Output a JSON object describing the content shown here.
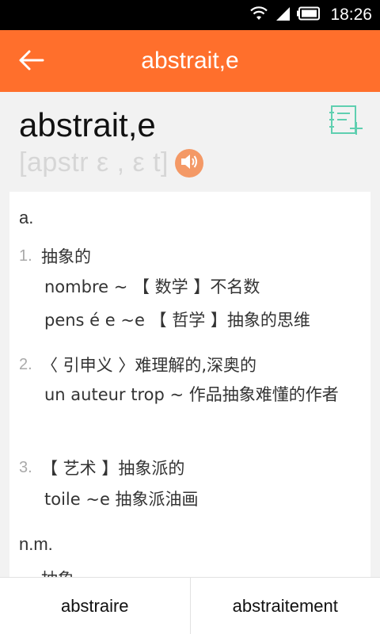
{
  "status_bar": {
    "time": "18:26",
    "icons": [
      "wifi-icon",
      "signal-icon",
      "battery-icon"
    ]
  },
  "app_bar": {
    "title": "abstrait,e",
    "back_icon": "arrow-left-icon"
  },
  "entry": {
    "word": "abstrait,e",
    "phonetic": "[apstr ε , ε t]",
    "speaker_icon": "speaker-icon",
    "add_icon": "add-to-notebook-icon"
  },
  "definitions": [
    {
      "pos": "a.",
      "senses": [
        {
          "num": "1.",
          "text": "抽象的",
          "examples": [
            "nombre ~ 【 数学 】不名数",
            "pens é e ~e 【 哲学 】抽象的思维"
          ]
        },
        {
          "num": "2.",
          "text": "〈 引申义 〉难理解的,深奥的",
          "examples": [
            "un auteur trop ~ 作品抽象难懂的作者"
          ]
        },
        {
          "num": "3.",
          "text": "【 艺术 】抽象派的",
          "examples": [
            "toile ~e 抽象派油画"
          ]
        }
      ]
    },
    {
      "pos": "n.m.",
      "partial_text": "抽象"
    }
  ],
  "related_words": [
    "abstraire",
    "abstraitement"
  ],
  "colors": {
    "accent": "#ff6f2c",
    "speaker_bg": "#f49966",
    "notebook_icon": "#5fcfb0"
  }
}
